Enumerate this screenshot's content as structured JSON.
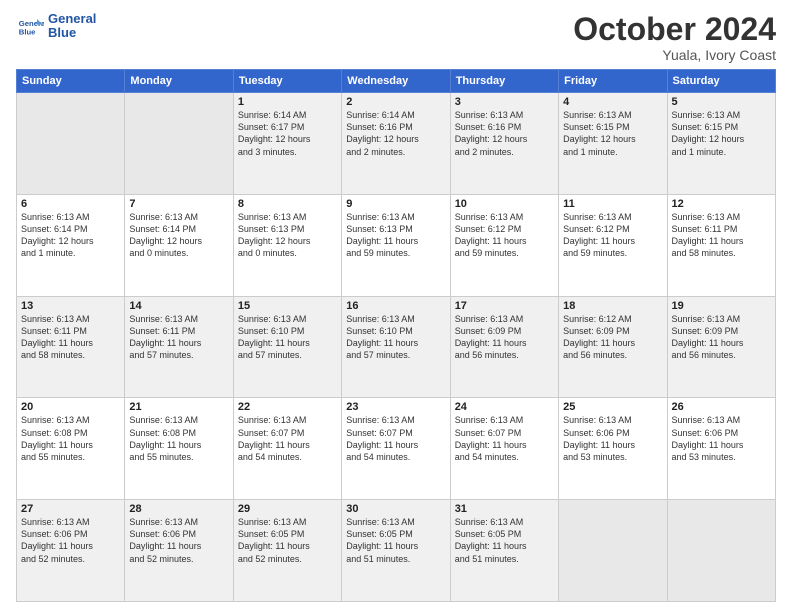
{
  "logo": {
    "line1": "General",
    "line2": "Blue"
  },
  "header": {
    "month": "October 2024",
    "location": "Yuala, Ivory Coast"
  },
  "weekdays": [
    "Sunday",
    "Monday",
    "Tuesday",
    "Wednesday",
    "Thursday",
    "Friday",
    "Saturday"
  ],
  "weeks": [
    [
      {
        "day": "",
        "info": "",
        "empty": true
      },
      {
        "day": "",
        "info": "",
        "empty": true
      },
      {
        "day": "1",
        "info": "Sunrise: 6:14 AM\nSunset: 6:17 PM\nDaylight: 12 hours\nand 3 minutes."
      },
      {
        "day": "2",
        "info": "Sunrise: 6:14 AM\nSunset: 6:16 PM\nDaylight: 12 hours\nand 2 minutes."
      },
      {
        "day": "3",
        "info": "Sunrise: 6:13 AM\nSunset: 6:16 PM\nDaylight: 12 hours\nand 2 minutes."
      },
      {
        "day": "4",
        "info": "Sunrise: 6:13 AM\nSunset: 6:15 PM\nDaylight: 12 hours\nand 1 minute."
      },
      {
        "day": "5",
        "info": "Sunrise: 6:13 AM\nSunset: 6:15 PM\nDaylight: 12 hours\nand 1 minute."
      }
    ],
    [
      {
        "day": "6",
        "info": "Sunrise: 6:13 AM\nSunset: 6:14 PM\nDaylight: 12 hours\nand 1 minute."
      },
      {
        "day": "7",
        "info": "Sunrise: 6:13 AM\nSunset: 6:14 PM\nDaylight: 12 hours\nand 0 minutes."
      },
      {
        "day": "8",
        "info": "Sunrise: 6:13 AM\nSunset: 6:13 PM\nDaylight: 12 hours\nand 0 minutes."
      },
      {
        "day": "9",
        "info": "Sunrise: 6:13 AM\nSunset: 6:13 PM\nDaylight: 11 hours\nand 59 minutes."
      },
      {
        "day": "10",
        "info": "Sunrise: 6:13 AM\nSunset: 6:12 PM\nDaylight: 11 hours\nand 59 minutes."
      },
      {
        "day": "11",
        "info": "Sunrise: 6:13 AM\nSunset: 6:12 PM\nDaylight: 11 hours\nand 59 minutes."
      },
      {
        "day": "12",
        "info": "Sunrise: 6:13 AM\nSunset: 6:11 PM\nDaylight: 11 hours\nand 58 minutes."
      }
    ],
    [
      {
        "day": "13",
        "info": "Sunrise: 6:13 AM\nSunset: 6:11 PM\nDaylight: 11 hours\nand 58 minutes."
      },
      {
        "day": "14",
        "info": "Sunrise: 6:13 AM\nSunset: 6:11 PM\nDaylight: 11 hours\nand 57 minutes."
      },
      {
        "day": "15",
        "info": "Sunrise: 6:13 AM\nSunset: 6:10 PM\nDaylight: 11 hours\nand 57 minutes."
      },
      {
        "day": "16",
        "info": "Sunrise: 6:13 AM\nSunset: 6:10 PM\nDaylight: 11 hours\nand 57 minutes."
      },
      {
        "day": "17",
        "info": "Sunrise: 6:13 AM\nSunset: 6:09 PM\nDaylight: 11 hours\nand 56 minutes."
      },
      {
        "day": "18",
        "info": "Sunrise: 6:12 AM\nSunset: 6:09 PM\nDaylight: 11 hours\nand 56 minutes."
      },
      {
        "day": "19",
        "info": "Sunrise: 6:13 AM\nSunset: 6:09 PM\nDaylight: 11 hours\nand 56 minutes."
      }
    ],
    [
      {
        "day": "20",
        "info": "Sunrise: 6:13 AM\nSunset: 6:08 PM\nDaylight: 11 hours\nand 55 minutes."
      },
      {
        "day": "21",
        "info": "Sunrise: 6:13 AM\nSunset: 6:08 PM\nDaylight: 11 hours\nand 55 minutes."
      },
      {
        "day": "22",
        "info": "Sunrise: 6:13 AM\nSunset: 6:07 PM\nDaylight: 11 hours\nand 54 minutes."
      },
      {
        "day": "23",
        "info": "Sunrise: 6:13 AM\nSunset: 6:07 PM\nDaylight: 11 hours\nand 54 minutes."
      },
      {
        "day": "24",
        "info": "Sunrise: 6:13 AM\nSunset: 6:07 PM\nDaylight: 11 hours\nand 54 minutes."
      },
      {
        "day": "25",
        "info": "Sunrise: 6:13 AM\nSunset: 6:06 PM\nDaylight: 11 hours\nand 53 minutes."
      },
      {
        "day": "26",
        "info": "Sunrise: 6:13 AM\nSunset: 6:06 PM\nDaylight: 11 hours\nand 53 minutes."
      }
    ],
    [
      {
        "day": "27",
        "info": "Sunrise: 6:13 AM\nSunset: 6:06 PM\nDaylight: 11 hours\nand 52 minutes."
      },
      {
        "day": "28",
        "info": "Sunrise: 6:13 AM\nSunset: 6:06 PM\nDaylight: 11 hours\nand 52 minutes."
      },
      {
        "day": "29",
        "info": "Sunrise: 6:13 AM\nSunset: 6:05 PM\nDaylight: 11 hours\nand 52 minutes."
      },
      {
        "day": "30",
        "info": "Sunrise: 6:13 AM\nSunset: 6:05 PM\nDaylight: 11 hours\nand 51 minutes."
      },
      {
        "day": "31",
        "info": "Sunrise: 6:13 AM\nSunset: 6:05 PM\nDaylight: 11 hours\nand 51 minutes."
      },
      {
        "day": "",
        "info": "",
        "empty": true
      },
      {
        "day": "",
        "info": "",
        "empty": true
      }
    ]
  ]
}
